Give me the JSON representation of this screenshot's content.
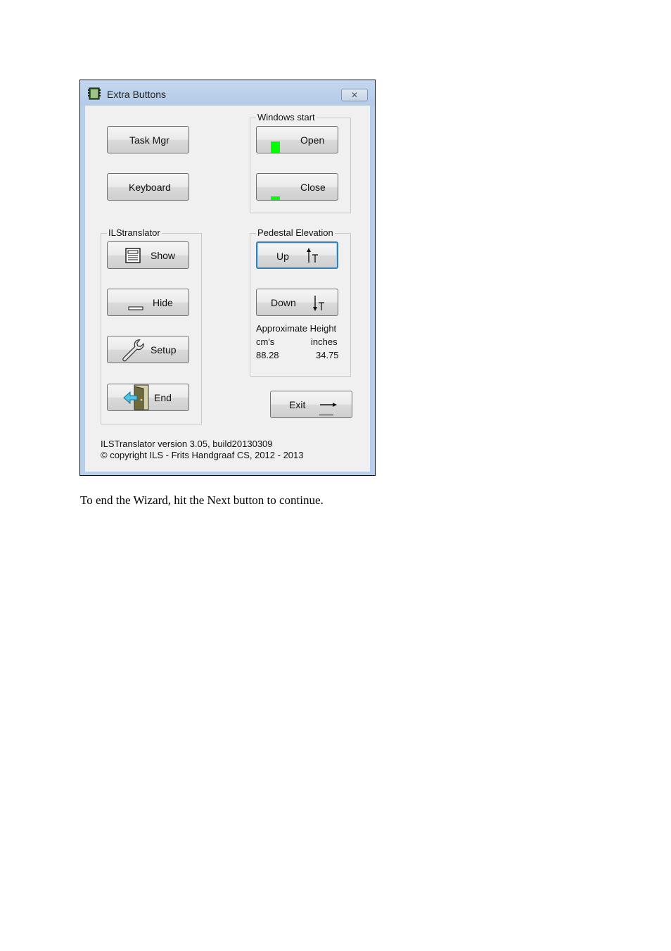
{
  "window": {
    "title": "Extra Buttons",
    "close_symbol": "✕"
  },
  "buttons": {
    "task_mgr": "Task Mgr",
    "keyboard": "Keyboard",
    "show": "Show",
    "hide": "Hide",
    "setup": "Setup",
    "end": "End",
    "open": "Open",
    "close": "Close",
    "up": "Up",
    "down": "Down",
    "exit": "Exit"
  },
  "groups": {
    "windows_start": "Windows start",
    "ilstranslator": "ILStranslator",
    "pedestal_elevation": "Pedestal Elevation"
  },
  "height": {
    "label": "Approximate Height",
    "cm_label": "cm's",
    "inch_label": "inches",
    "cm_value": "88.28",
    "inch_value": "34.75"
  },
  "footer": {
    "version": "ILSTranslator version 3.05, build20130309",
    "copyright": "© copyright ILS - Frits Handgraaf CS, 2012 - 2013"
  },
  "caption": "To end the Wizard, hit the Next button to continue.",
  "colors": {
    "accent": "#3c7fb1",
    "indicator": "#00ff00",
    "frame": "#b9cfe9"
  }
}
